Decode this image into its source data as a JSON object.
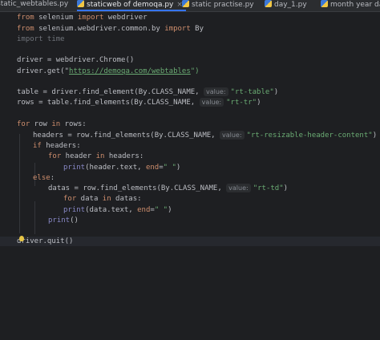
{
  "tabs": [
    {
      "label": "static_webtables.py",
      "active": false,
      "closable": false
    },
    {
      "label": "staticweb of demoqa.py",
      "active": true,
      "closable": true
    },
    {
      "label": "static practise.py",
      "active": false,
      "closable": false
    },
    {
      "label": "day_1.py",
      "active": false,
      "closable": false
    },
    {
      "label": "month year day",
      "active": false,
      "closable": false
    }
  ],
  "close_glyph": "×",
  "code": {
    "l1": {
      "kw1": "from",
      "mod": " selenium ",
      "kw2": "import",
      "name": " webdriver"
    },
    "l2": {
      "kw1": "from",
      "mod": " selenium.webdriver.common.by ",
      "kw2": "import",
      "name": " By"
    },
    "l3": {
      "text": "import time"
    },
    "l5": {
      "text": "driver = webdriver.Chrome()"
    },
    "l6": {
      "pre": "driver.get(\"",
      "url": "https://demoqa.com/webtables",
      "post": "\")"
    },
    "l8": {
      "pre": "table = driver.find_element(By.CLASS_NAME, ",
      "hint": "value:",
      "str": "\"rt-table\"",
      "post": ")"
    },
    "l9": {
      "pre": "rows = table.find_elements(By.CLASS_NAME, ",
      "hint": "value:",
      "str": "\"rt-tr\"",
      "post": ")"
    },
    "l11": {
      "kw1": "for",
      "mid": " row ",
      "kw2": "in",
      "post": " rows:"
    },
    "l12": {
      "pre": "headers = row.find_elements(By.CLASS_NAME, ",
      "hint": "value:",
      "str": "\"rt-resizable-header-content\"",
      "post": ")"
    },
    "l13": {
      "kw": "if",
      "post": " headers:"
    },
    "l14": {
      "kw1": "for",
      "mid": " header ",
      "kw2": "in",
      "post": " headers:"
    },
    "l15": {
      "fn": "print",
      "pre": "(header.text, ",
      "kw": "end",
      "eq": "=",
      "str": "\" \"",
      "post": ")"
    },
    "l16": {
      "kw": "else",
      "post": ":"
    },
    "l17": {
      "pre": "datas = row.find_elements(By.CLASS_NAME, ",
      "hint": "value:",
      "str": "\"rt-td\"",
      "post": ")"
    },
    "l18": {
      "kw1": "for",
      "mid": " data ",
      "kw2": "in",
      "post": " datas:"
    },
    "l19": {
      "fn": "print",
      "pre": "(data.text, ",
      "kw": "end",
      "eq": "=",
      "str": "\" \"",
      "post": ")"
    },
    "l20": {
      "fn": "print",
      "post": "()"
    },
    "l22": {
      "text": "driver.quit()"
    }
  },
  "colors": {
    "background": "#1e1f22",
    "keyword": "#cf8e6d",
    "string": "#6aab73",
    "builtin": "#8888c6",
    "accent": "#3574f0"
  },
  "icons": [
    "python-file-icon",
    "close-icon",
    "lightbulb-icon"
  ]
}
